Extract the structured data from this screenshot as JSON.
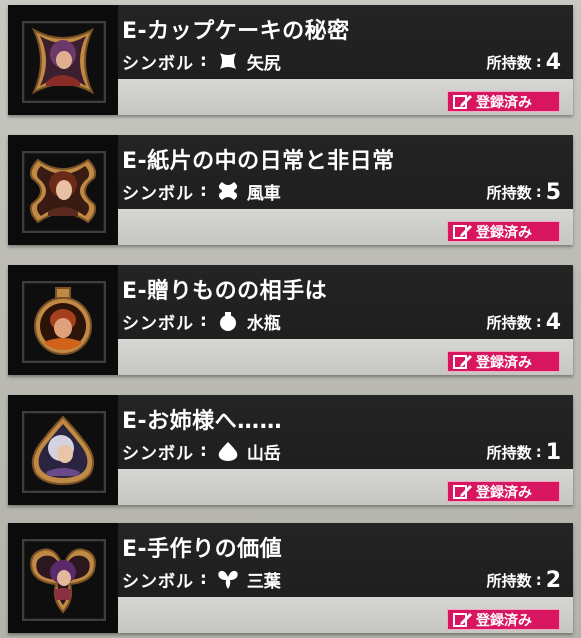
{
  "cards": [
    {
      "title": "E-カップケーキの秘密",
      "symbol_label": "シンボル",
      "symbol_icon": "sandglass-symbol-icon",
      "symbol_name": "矢尻",
      "count_label": "所持数",
      "count": "4",
      "status": "登録済み",
      "portrait": "purple-haired-character-portrait",
      "frame_shape": "sandglass"
    },
    {
      "title": "E-紙片の中の日常と非日常",
      "symbol_label": "シンボル",
      "symbol_icon": "cross-symbol-icon",
      "symbol_name": "風車",
      "count_label": "所持数",
      "count": "5",
      "status": "登録済み",
      "portrait": "brown-haired-woman-portrait",
      "frame_shape": "cross"
    },
    {
      "title": "E-贈りものの相手は",
      "symbol_label": "シンボル",
      "symbol_icon": "flask-symbol-icon",
      "symbol_name": "水瓶",
      "count_label": "所持数",
      "count": "4",
      "status": "登録済み",
      "portrait": "red-haired-man-portrait",
      "frame_shape": "flask"
    },
    {
      "title": "E-お姉様へ……",
      "symbol_label": "シンボル",
      "symbol_icon": "mountain-symbol-icon",
      "symbol_name": "山岳",
      "count_label": "所持数",
      "count": "1",
      "status": "登録済み",
      "portrait": "silver-haired-character-portrait",
      "frame_shape": "mountain"
    },
    {
      "title": "E-手作りの価値",
      "symbol_label": "シンボル",
      "symbol_icon": "trefoil-symbol-icon",
      "symbol_name": "三葉",
      "count_label": "所持数",
      "count": "2",
      "status": "登録済み",
      "portrait": "purple-haired-girl-portrait",
      "frame_shape": "trefoil"
    }
  ],
  "colors": {
    "badge": "#d8155f",
    "frame_gold": "#b07a3a",
    "card_bg": "#111111",
    "bar_bg": "#cfcfcc"
  },
  "icons": {
    "registered": "memo-pencil-icon"
  }
}
